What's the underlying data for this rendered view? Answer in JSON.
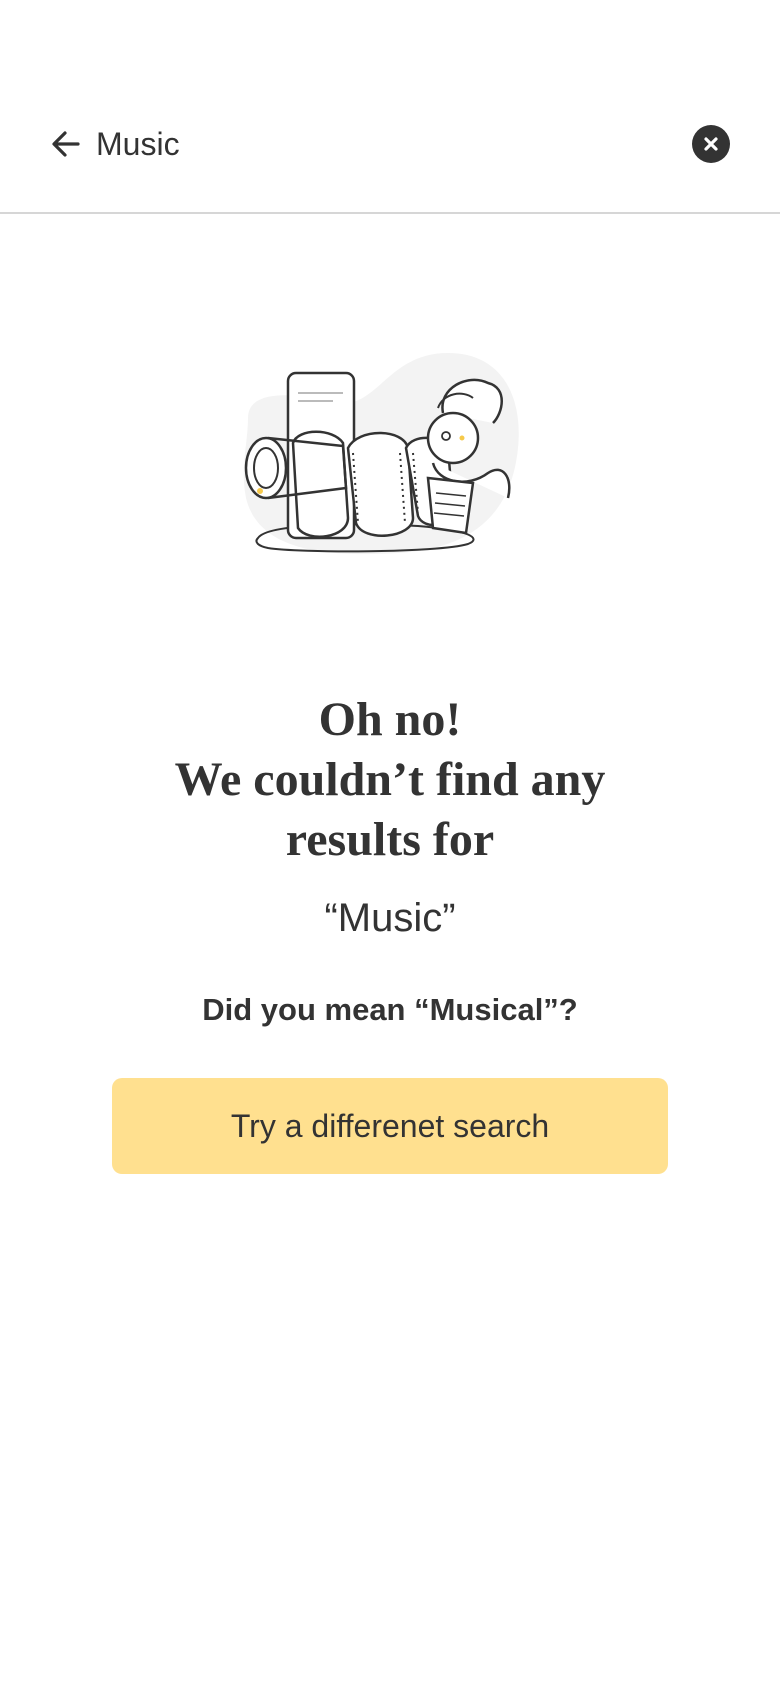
{
  "header": {
    "query": "Music",
    "back_icon": "arrow-left-icon",
    "clear_icon": "close-circle-icon"
  },
  "empty_state": {
    "illustration_icon": "searching-person-illustration",
    "heading_line1": "Oh no!",
    "heading_line2": "We couldn’t find any",
    "heading_line3": "results for",
    "query_quoted": "“Music”",
    "suggestion": "Did you mean “Musical”?",
    "retry_label": "Try a differenet search"
  },
  "colors": {
    "text": "#333333",
    "button_bg": "#ffe08f",
    "divider": "#d6d6d6"
  }
}
